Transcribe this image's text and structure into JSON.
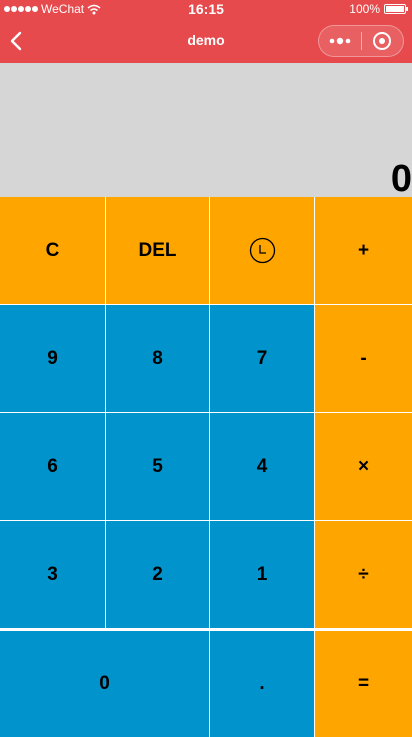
{
  "status_bar": {
    "carrier": "WeChat",
    "time": "16:15",
    "battery_text": "100%",
    "battery_level": 1.0
  },
  "nav": {
    "title": "demo",
    "back_icon": "chevron-left-icon",
    "more_icon": "more-dots-icon",
    "close_icon": "target-circle-icon"
  },
  "display": {
    "value": "0"
  },
  "colors": {
    "header": "#e64a4d",
    "display_bg": "#d6d6d6",
    "operator_key": "#ffa500",
    "number_key": "#0093cc"
  },
  "keys": {
    "clear": "C",
    "delete": "DEL",
    "history_icon": "clock-icon",
    "plus": "+",
    "nine": "9",
    "eight": "8",
    "seven": "7",
    "minus": "-",
    "six": "6",
    "five": "5",
    "four": "4",
    "multiply": "×",
    "three": "3",
    "two": "2",
    "one": "1",
    "divide": "÷",
    "zero": "0",
    "dot": ".",
    "equals": "="
  }
}
